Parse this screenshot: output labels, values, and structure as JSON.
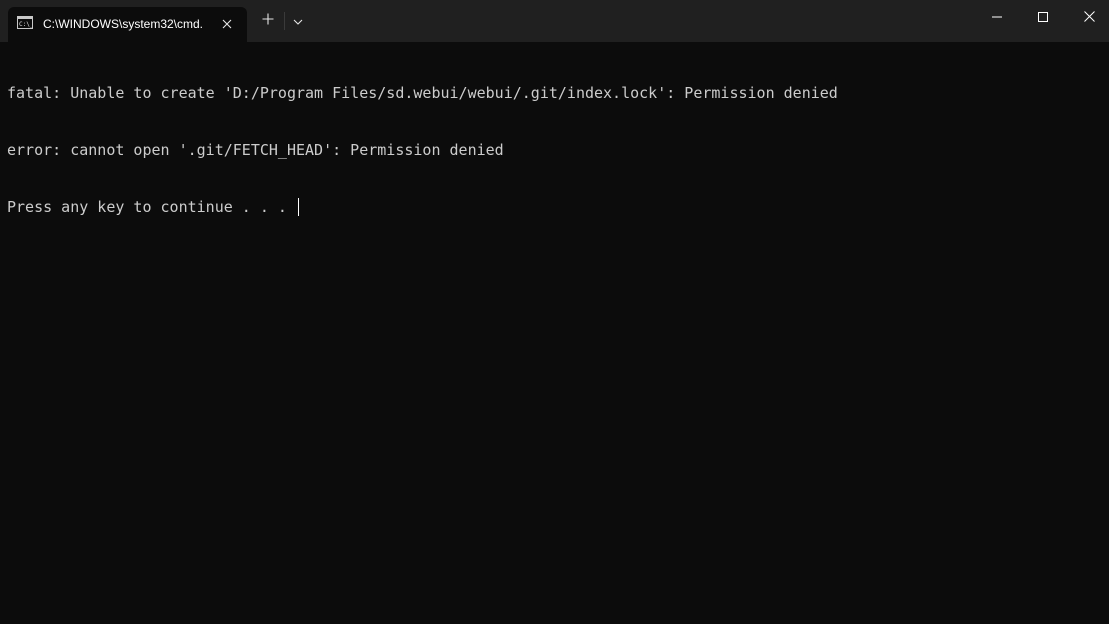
{
  "tab": {
    "title": "C:\\WINDOWS\\system32\\cmd.",
    "icon": "cmd-icon"
  },
  "titlebar_icons": {
    "close_tab": "close-icon",
    "new_tab": "plus-icon",
    "dropdown": "chevron-down-icon",
    "minimize": "minimize-icon",
    "maximize": "maximize-icon",
    "close_window": "close-icon"
  },
  "terminal": {
    "lines": [
      "fatal: Unable to create 'D:/Program Files/sd.webui/webui/.git/index.lock': Permission denied",
      "error: cannot open '.git/FETCH_HEAD': Permission denied",
      "Press any key to continue . . . "
    ]
  },
  "colors": {
    "background": "#0c0c0c",
    "titlebar": "#202020",
    "text": "#cccccc"
  }
}
